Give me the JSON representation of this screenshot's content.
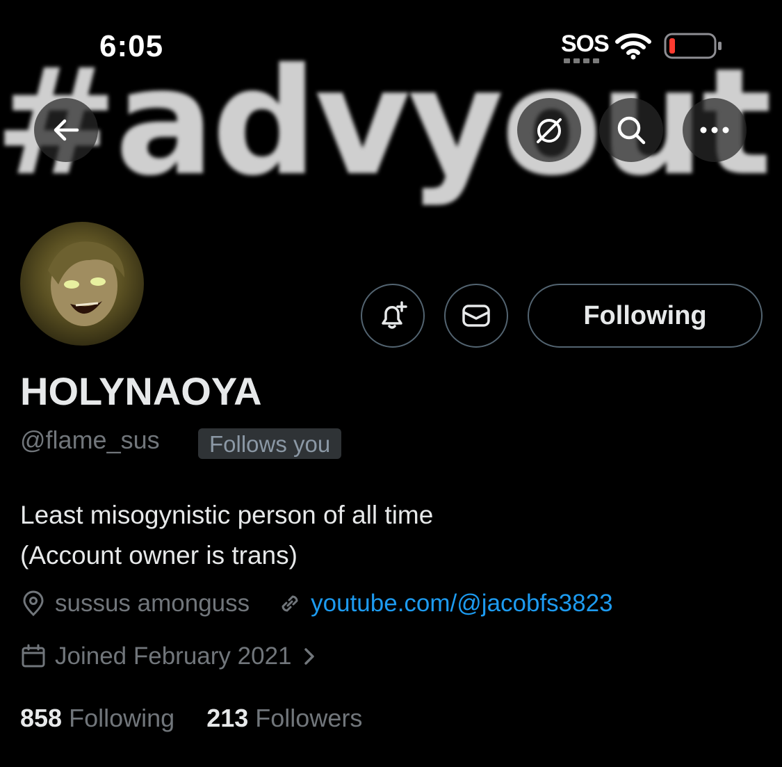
{
  "status_bar": {
    "time": "6:05",
    "sos": "SOS"
  },
  "banner": {
    "text": "#advyout"
  },
  "header": {
    "back_icon": "arrow-left-icon",
    "grok_icon": "grok-icon",
    "search_icon": "search-icon",
    "more_icon": "more-horizontal-icon"
  },
  "actions": {
    "notify_icon": "bell-plus-icon",
    "message_icon": "envelope-icon",
    "following_label": "Following"
  },
  "profile": {
    "name": "HOLYNAOYA",
    "handle": "@flame_sus",
    "follows_you": "Follows you",
    "bio": [
      "Least misogynistic person of all time",
      "(Account owner is trans)"
    ],
    "location": "sussus amonguss",
    "website": "youtube.com/@jacobfs3823",
    "joined": "Joined February 2021",
    "following_count": "858",
    "following_label": "Following",
    "followers_count": "213",
    "followers_label": "Followers"
  },
  "colors": {
    "background": "#000000",
    "text_primary": "#e7e9ea",
    "text_secondary": "#71767b",
    "link": "#1d9bf0",
    "border": "#536471",
    "battery_low": "#ff3b30"
  }
}
